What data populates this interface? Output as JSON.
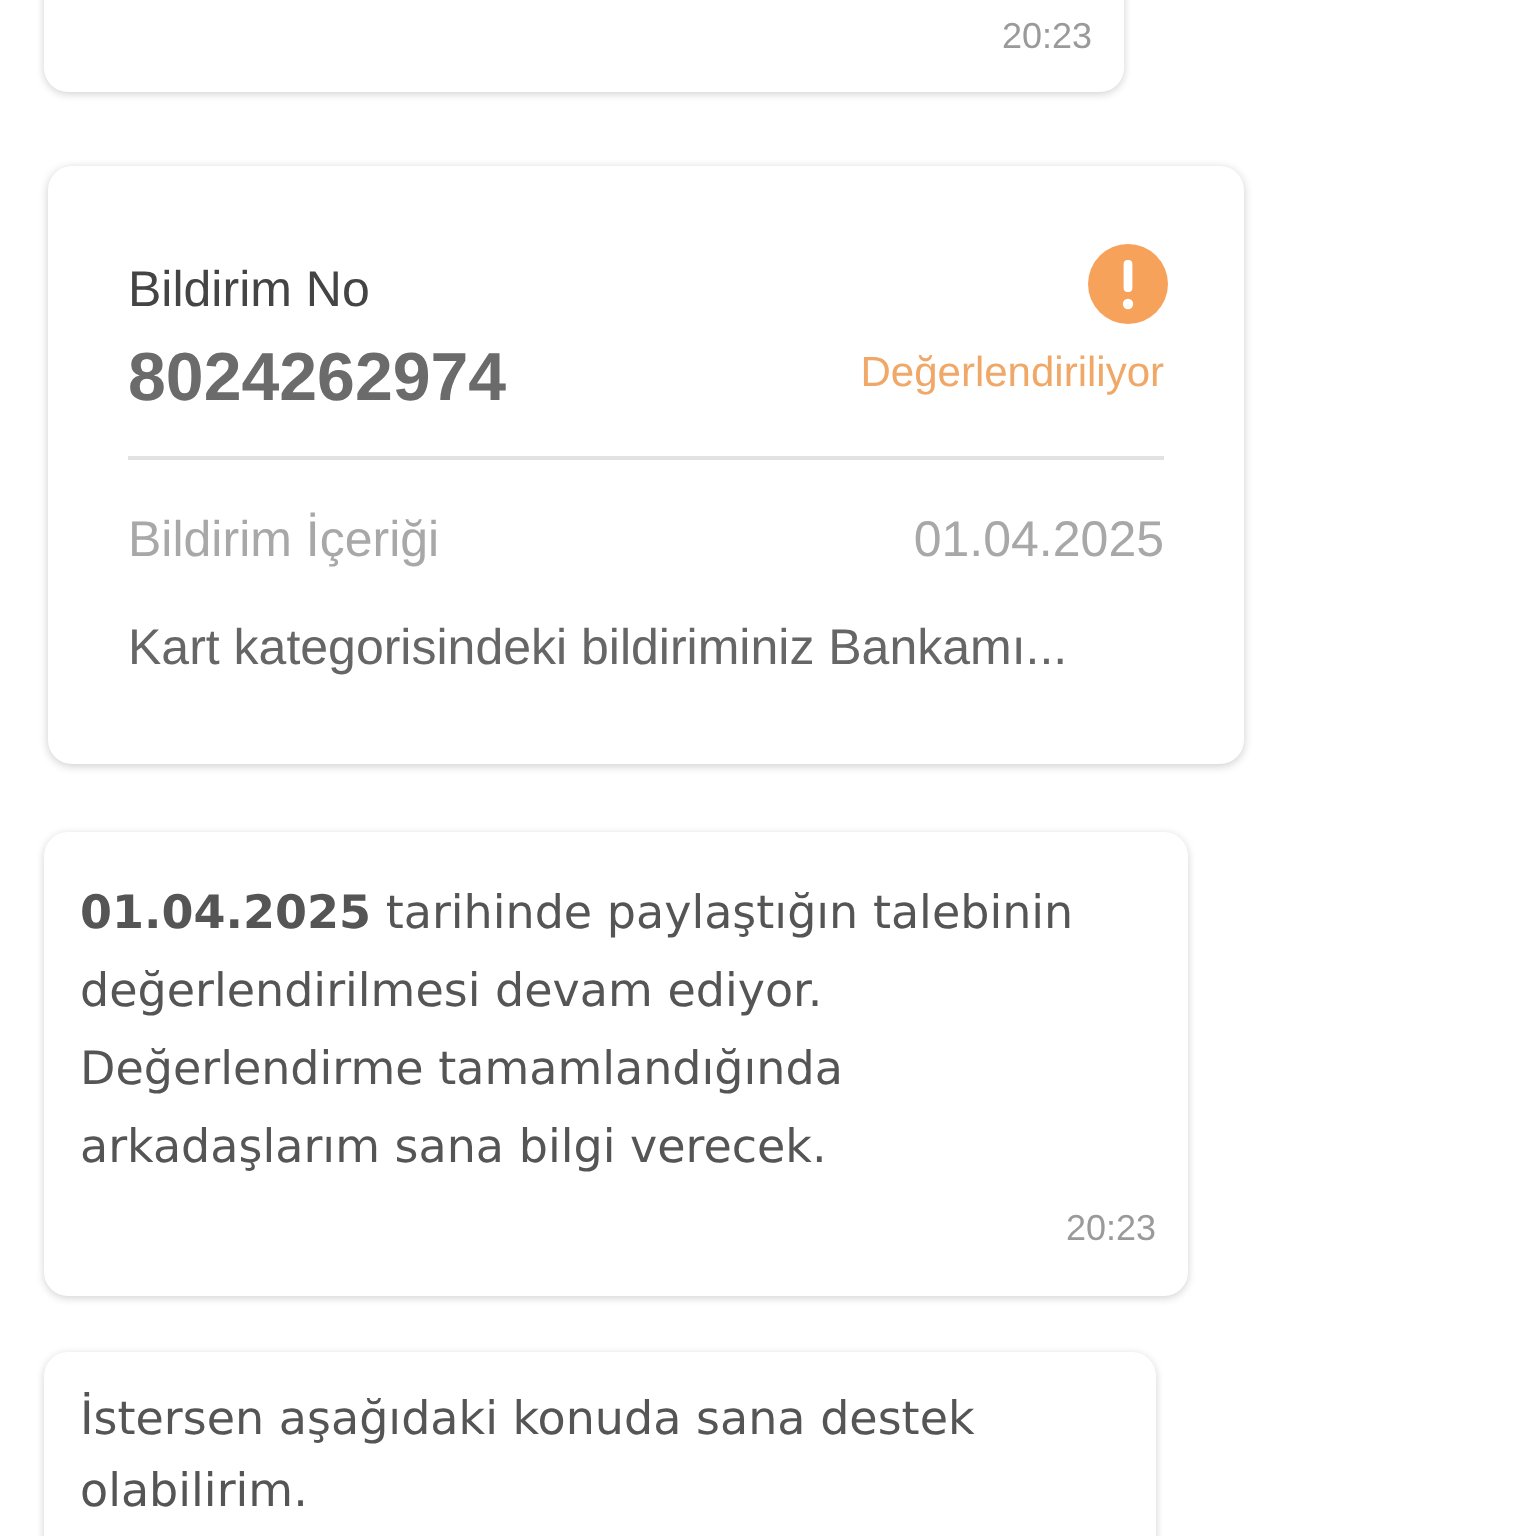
{
  "messages": [
    {
      "kind": "time_only",
      "time": "20:23"
    },
    {
      "kind": "ticket",
      "label": "Bildirim No",
      "number": "8024262974",
      "status": "Değerlendiriliyor",
      "content_label": "Bildirim İçeriği",
      "date": "01.04.2025",
      "content": "Kart kategorisindeki bildiriminiz Bankamı..."
    },
    {
      "kind": "text",
      "text": "**01.04.2025** tarihinde paylaştığın talebinin değerlendirilmesi devam ediyor. Değerlendirme tamamlandığında arkadaşlarım sana bilgi verecek.",
      "time": "20:23"
    },
    {
      "kind": "text",
      "text": "İstersen aşağıdaki konuda sana destek olabilirim."
    }
  ]
}
